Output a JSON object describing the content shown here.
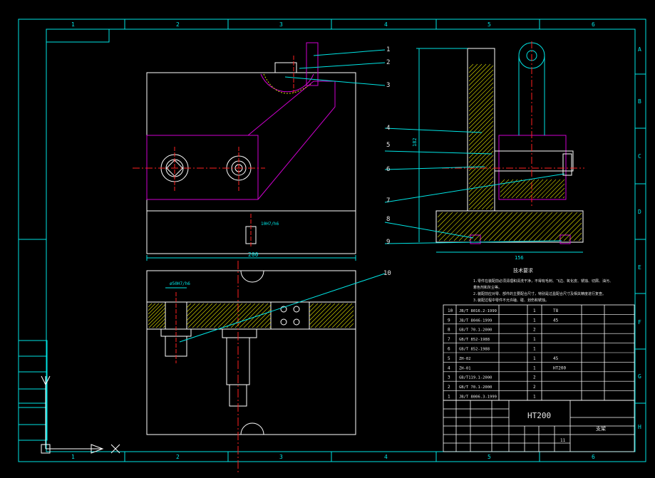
{
  "colors": {
    "background": "#000000",
    "frame": "#00e5e5",
    "outline": "#ffffff",
    "hidden_part": "#d000d0",
    "centerline": "#ff2020",
    "hatch": "#d8d800",
    "leader": "#00e5e5",
    "table_text": "#e8e8e8",
    "side_labels": "#00d000"
  },
  "grid": {
    "columns": [
      "1",
      "2",
      "3",
      "4",
      "5",
      "6"
    ],
    "rows": [
      "A",
      "B",
      "C",
      "D",
      "E",
      "F",
      "G",
      "H"
    ]
  },
  "callouts": [
    "1",
    "2",
    "3",
    "4",
    "5",
    "6",
    "7",
    "8",
    "9",
    "10"
  ],
  "dimensions": {
    "front_width": "200",
    "fit_tolerance": "10H7/h6",
    "bore_tolerance": "ø50H7/h6",
    "side_height": "182",
    "side_width": "156"
  },
  "tech_req": {
    "title": "技术要求",
    "lines": [
      "1.零件在装配前必须清理和清洗干净，不得有毛刺、飞边、氧化皮、锈蚀、切屑、油污、",
      "着色剂和灰尘等。",
      "2.装配前应对零、部件的主要配合尺寸，特别是过盈配合尺寸及相关精度进行复查。",
      "3.装配过程中零件不允许磕、碰、划伤和锈蚀。"
    ]
  },
  "bom": {
    "rows": [
      {
        "no": "10",
        "code": "JB/T 8016.2-1999",
        "name": "",
        "qty": "1",
        "mat": "T8",
        "note": ""
      },
      {
        "no": "9",
        "code": "JB/T 8046-1999",
        "name": "",
        "qty": "1",
        "mat": "45",
        "note": ""
      },
      {
        "no": "8",
        "code": "GB/T 70.1-2000",
        "name": "",
        "qty": "2",
        "mat": "",
        "note": ""
      },
      {
        "no": "7",
        "code": "GB/T 852-1988",
        "name": "",
        "qty": "1",
        "mat": "",
        "note": ""
      },
      {
        "no": "6",
        "code": "GB/T 852-1988",
        "name": "",
        "qty": "1",
        "mat": "",
        "note": ""
      },
      {
        "no": "5",
        "code": "ZH-02",
        "name": "",
        "qty": "1",
        "mat": "45",
        "note": ""
      },
      {
        "no": "4",
        "code": "ZH-01",
        "name": "",
        "qty": "1",
        "mat": "HT200",
        "note": ""
      },
      {
        "no": "3",
        "code": "GB/T119.1-2000",
        "name": "",
        "qty": "2",
        "mat": "",
        "note": ""
      },
      {
        "no": "2",
        "code": "GB/T 70.1-2000",
        "name": "",
        "qty": "2",
        "mat": "",
        "note": ""
      },
      {
        "no": "1",
        "code": "JB/T 8006.3-1999",
        "name": "",
        "qty": "1",
        "mat": "",
        "note": ""
      }
    ]
  },
  "title_block": {
    "material": "HT200",
    "drawing_name": "支架",
    "scale_small": "11"
  },
  "side_labels": [
    "",
    "",
    "",
    "",
    "",
    ""
  ]
}
